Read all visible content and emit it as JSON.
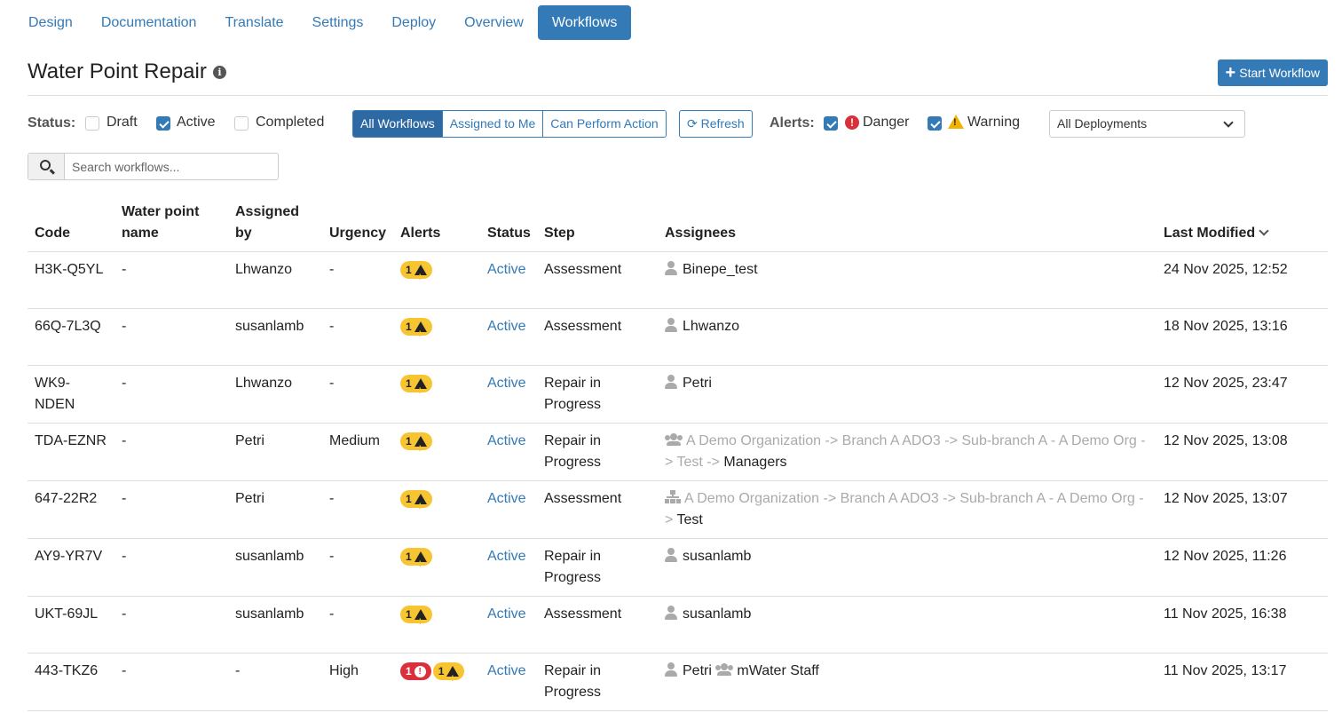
{
  "nav": {
    "tabs": [
      {
        "label": "Design"
      },
      {
        "label": "Documentation"
      },
      {
        "label": "Translate"
      },
      {
        "label": "Settings"
      },
      {
        "label": "Deploy"
      },
      {
        "label": "Overview"
      },
      {
        "label": "Workflows",
        "active": true
      }
    ]
  },
  "header": {
    "title": "Water Point Repair",
    "start_button": "Start Workflow"
  },
  "filters": {
    "status_label": "Status:",
    "status_options": [
      {
        "label": "Draft",
        "checked": false
      },
      {
        "label": "Active",
        "checked": true
      },
      {
        "label": "Completed",
        "checked": false
      }
    ],
    "views": [
      "All Workflows",
      "Assigned to Me",
      "Can Perform Action"
    ],
    "active_view": "All Workflows",
    "refresh": "Refresh",
    "alerts_label": "Alerts:",
    "alert_options": [
      {
        "label": "Danger",
        "checked": true
      },
      {
        "label": "Warning",
        "checked": true
      }
    ],
    "deployment": "All Deployments"
  },
  "search": {
    "placeholder": "Search workflows..."
  },
  "table": {
    "columns": {
      "code": "Code",
      "water_point_name": "Water point name",
      "assigned_by": "Assigned by",
      "urgency": "Urgency",
      "alerts": "Alerts",
      "status": "Status",
      "step": "Step",
      "assignees": "Assignees",
      "last_modified": "Last Modified"
    },
    "rows": [
      {
        "code": "H3K-Q5YL",
        "name": "-",
        "assigned_by": "Lhwanzo",
        "urgency": "-",
        "danger": null,
        "warning": "1",
        "status": "Active",
        "step": "Assessment",
        "assignees": [
          {
            "type": "user",
            "name": "Binepe_test"
          }
        ],
        "modified": "24 Nov 2025, 12:52"
      },
      {
        "code": "66Q-7L3Q",
        "name": "-",
        "assigned_by": "susanlamb",
        "urgency": "-",
        "danger": null,
        "warning": "1",
        "status": "Active",
        "step": "Assessment",
        "assignees": [
          {
            "type": "user",
            "name": "Lhwanzo"
          }
        ],
        "modified": "18 Nov 2025, 13:16"
      },
      {
        "code": "WK9-NDEN",
        "name": "-",
        "assigned_by": "Lhwanzo",
        "urgency": "-",
        "danger": null,
        "warning": "1",
        "status": "Active",
        "step": "Repair in Progress",
        "assignees": [
          {
            "type": "user",
            "name": "Petri"
          }
        ],
        "modified": "12 Nov 2025, 23:47"
      },
      {
        "code": "TDA-EZNR",
        "name": "-",
        "assigned_by": "Petri",
        "urgency": "Medium",
        "danger": null,
        "warning": "1",
        "status": "Active",
        "step": "Repair in Progress",
        "assignees": [
          {
            "type": "group",
            "path": "A Demo Organization -> Branch A ADO3 -> Sub-branch A - A Demo Org - > Test -> ",
            "name": "Managers"
          }
        ],
        "modified": "12 Nov 2025, 13:08"
      },
      {
        "code": "647-22R2",
        "name": "-",
        "assigned_by": "Petri",
        "urgency": "-",
        "danger": null,
        "warning": "1",
        "status": "Active",
        "step": "Assessment",
        "assignees": [
          {
            "type": "org",
            "path": "A Demo Organization -> Branch A ADO3 -> Sub-branch A - A Demo Org - > ",
            "name": "Test"
          }
        ],
        "modified": "12 Nov 2025, 13:07"
      },
      {
        "code": "AY9-YR7V",
        "name": "-",
        "assigned_by": "susanlamb",
        "urgency": "-",
        "danger": null,
        "warning": "1",
        "status": "Active",
        "step": "Repair in Progress",
        "assignees": [
          {
            "type": "user",
            "name": "susanlamb"
          }
        ],
        "modified": "12 Nov 2025, 11:26"
      },
      {
        "code": "UKT-69JL",
        "name": "-",
        "assigned_by": "susanlamb",
        "urgency": "-",
        "danger": null,
        "warning": "1",
        "status": "Active",
        "step": "Assessment",
        "assignees": [
          {
            "type": "user",
            "name": "susanlamb"
          }
        ],
        "modified": "11 Nov 2025, 16:38"
      },
      {
        "code": "443-TKZ6",
        "name": "-",
        "assigned_by": "-",
        "urgency": "High",
        "danger": "1",
        "warning": "1",
        "status": "Active",
        "step": "Repair in Progress",
        "assignees": [
          {
            "type": "user",
            "name": "Petri"
          },
          {
            "type": "group",
            "name": "mWater Staff"
          }
        ],
        "modified": "11 Nov 2025, 13:17"
      }
    ]
  },
  "colors": {
    "primary": "#337ab7",
    "danger": "#d9303c",
    "warning": "#f7c531"
  }
}
